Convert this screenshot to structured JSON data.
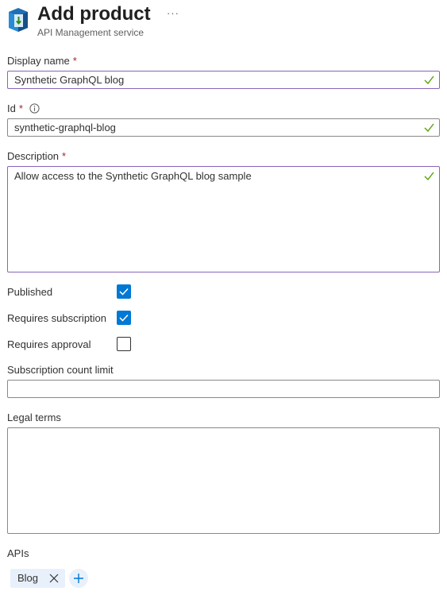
{
  "header": {
    "title": "Add product",
    "subtitle": "API Management service",
    "more_label": "···"
  },
  "form": {
    "required_marker": "*",
    "display_name": {
      "label": "Display name",
      "value": "Synthetic GraphQL blog",
      "valid": true
    },
    "id": {
      "label": "Id",
      "value": "synthetic-graphql-blog",
      "valid": true
    },
    "description": {
      "label": "Description",
      "value": "Allow access to the Synthetic GraphQL blog sample",
      "valid": true
    },
    "published": {
      "label": "Published",
      "checked": true
    },
    "requires_subscription": {
      "label": "Requires subscription",
      "checked": true
    },
    "requires_approval": {
      "label": "Requires approval",
      "checked": false
    },
    "subscription_count_limit": {
      "label": "Subscription count limit",
      "value": ""
    },
    "legal_terms": {
      "label": "Legal terms",
      "value": ""
    },
    "apis": {
      "label": "APIs",
      "items": [
        {
          "name": "Blog"
        }
      ]
    }
  },
  "colors": {
    "accent": "#0078d4",
    "valid_border": "#8764b8",
    "valid_check": "#57a300",
    "required": "#a4262c",
    "tag_bg": "#e8f1fb"
  }
}
